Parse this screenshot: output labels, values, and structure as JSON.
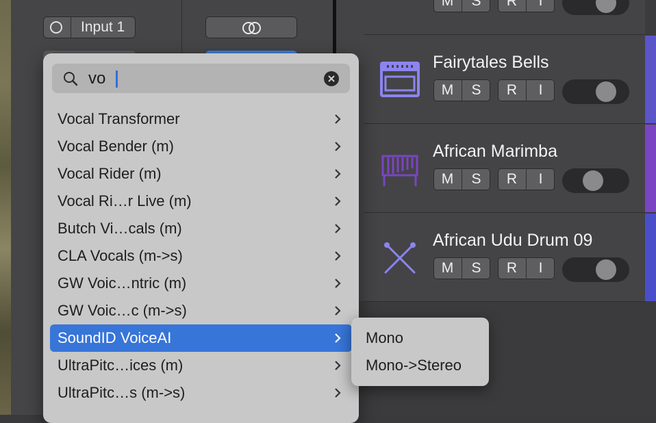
{
  "channel": {
    "input_label": "Input 1"
  },
  "tracks": [
    {
      "name": "",
      "icon": "drums-icon",
      "buttons": [
        "M",
        "S",
        "R",
        "I"
      ]
    },
    {
      "name": "Fairytales Bells",
      "icon": "keyboard-instrument-icon",
      "buttons": [
        "M",
        "S",
        "R",
        "I"
      ]
    },
    {
      "name": "African Marimba",
      "icon": "marimba-icon",
      "buttons": [
        "M",
        "S",
        "R",
        "I"
      ]
    },
    {
      "name": "African Udu Drum 09",
      "icon": "drumsticks-icon",
      "buttons": [
        "M",
        "S",
        "R",
        "I"
      ]
    }
  ],
  "menu": {
    "search_value": "vo",
    "items": [
      {
        "label": "Vocal Transformer"
      },
      {
        "label": "Vocal Bender (m)"
      },
      {
        "label": "Vocal Rider (m)"
      },
      {
        "label": "Vocal Ri…r Live (m)"
      },
      {
        "label": "Butch Vi…cals (m)"
      },
      {
        "label": "CLA Vocals (m->s)"
      },
      {
        "label": "GW Voic…ntric (m)"
      },
      {
        "label": "GW Voic…c (m->s)"
      },
      {
        "label": "SoundID VoiceAI",
        "selected": true
      },
      {
        "label": "UltraPitc…ices (m)"
      },
      {
        "label": "UltraPitc…s (m->s)"
      }
    ]
  },
  "submenu": {
    "items": [
      {
        "label": "Mono"
      },
      {
        "label": "Mono->Stereo"
      }
    ]
  },
  "colors": {
    "accent": "#3775d8",
    "track_icon": "#8c84f0",
    "color_strip": [
      "#5b55c9",
      "#7a45c2",
      "#4a4fc9"
    ]
  }
}
